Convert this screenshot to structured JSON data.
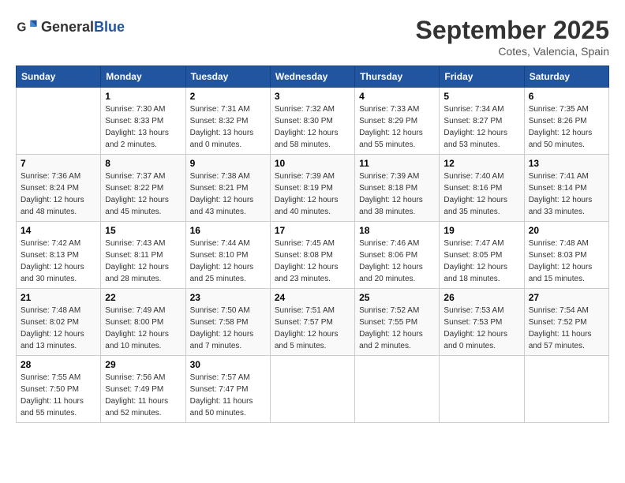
{
  "header": {
    "logo_general": "General",
    "logo_blue": "Blue",
    "month_title": "September 2025",
    "location": "Cotes, Valencia, Spain"
  },
  "days_of_week": [
    "Sunday",
    "Monday",
    "Tuesday",
    "Wednesday",
    "Thursday",
    "Friday",
    "Saturday"
  ],
  "weeks": [
    [
      {
        "day": "",
        "info": ""
      },
      {
        "day": "1",
        "info": "Sunrise: 7:30 AM\nSunset: 8:33 PM\nDaylight: 13 hours\nand 2 minutes."
      },
      {
        "day": "2",
        "info": "Sunrise: 7:31 AM\nSunset: 8:32 PM\nDaylight: 13 hours\nand 0 minutes."
      },
      {
        "day": "3",
        "info": "Sunrise: 7:32 AM\nSunset: 8:30 PM\nDaylight: 12 hours\nand 58 minutes."
      },
      {
        "day": "4",
        "info": "Sunrise: 7:33 AM\nSunset: 8:29 PM\nDaylight: 12 hours\nand 55 minutes."
      },
      {
        "day": "5",
        "info": "Sunrise: 7:34 AM\nSunset: 8:27 PM\nDaylight: 12 hours\nand 53 minutes."
      },
      {
        "day": "6",
        "info": "Sunrise: 7:35 AM\nSunset: 8:26 PM\nDaylight: 12 hours\nand 50 minutes."
      }
    ],
    [
      {
        "day": "7",
        "info": "Sunrise: 7:36 AM\nSunset: 8:24 PM\nDaylight: 12 hours\nand 48 minutes."
      },
      {
        "day": "8",
        "info": "Sunrise: 7:37 AM\nSunset: 8:22 PM\nDaylight: 12 hours\nand 45 minutes."
      },
      {
        "day": "9",
        "info": "Sunrise: 7:38 AM\nSunset: 8:21 PM\nDaylight: 12 hours\nand 43 minutes."
      },
      {
        "day": "10",
        "info": "Sunrise: 7:39 AM\nSunset: 8:19 PM\nDaylight: 12 hours\nand 40 minutes."
      },
      {
        "day": "11",
        "info": "Sunrise: 7:39 AM\nSunset: 8:18 PM\nDaylight: 12 hours\nand 38 minutes."
      },
      {
        "day": "12",
        "info": "Sunrise: 7:40 AM\nSunset: 8:16 PM\nDaylight: 12 hours\nand 35 minutes."
      },
      {
        "day": "13",
        "info": "Sunrise: 7:41 AM\nSunset: 8:14 PM\nDaylight: 12 hours\nand 33 minutes."
      }
    ],
    [
      {
        "day": "14",
        "info": "Sunrise: 7:42 AM\nSunset: 8:13 PM\nDaylight: 12 hours\nand 30 minutes."
      },
      {
        "day": "15",
        "info": "Sunrise: 7:43 AM\nSunset: 8:11 PM\nDaylight: 12 hours\nand 28 minutes."
      },
      {
        "day": "16",
        "info": "Sunrise: 7:44 AM\nSunset: 8:10 PM\nDaylight: 12 hours\nand 25 minutes."
      },
      {
        "day": "17",
        "info": "Sunrise: 7:45 AM\nSunset: 8:08 PM\nDaylight: 12 hours\nand 23 minutes."
      },
      {
        "day": "18",
        "info": "Sunrise: 7:46 AM\nSunset: 8:06 PM\nDaylight: 12 hours\nand 20 minutes."
      },
      {
        "day": "19",
        "info": "Sunrise: 7:47 AM\nSunset: 8:05 PM\nDaylight: 12 hours\nand 18 minutes."
      },
      {
        "day": "20",
        "info": "Sunrise: 7:48 AM\nSunset: 8:03 PM\nDaylight: 12 hours\nand 15 minutes."
      }
    ],
    [
      {
        "day": "21",
        "info": "Sunrise: 7:48 AM\nSunset: 8:02 PM\nDaylight: 12 hours\nand 13 minutes."
      },
      {
        "day": "22",
        "info": "Sunrise: 7:49 AM\nSunset: 8:00 PM\nDaylight: 12 hours\nand 10 minutes."
      },
      {
        "day": "23",
        "info": "Sunrise: 7:50 AM\nSunset: 7:58 PM\nDaylight: 12 hours\nand 7 minutes."
      },
      {
        "day": "24",
        "info": "Sunrise: 7:51 AM\nSunset: 7:57 PM\nDaylight: 12 hours\nand 5 minutes."
      },
      {
        "day": "25",
        "info": "Sunrise: 7:52 AM\nSunset: 7:55 PM\nDaylight: 12 hours\nand 2 minutes."
      },
      {
        "day": "26",
        "info": "Sunrise: 7:53 AM\nSunset: 7:53 PM\nDaylight: 12 hours\nand 0 minutes."
      },
      {
        "day": "27",
        "info": "Sunrise: 7:54 AM\nSunset: 7:52 PM\nDaylight: 11 hours\nand 57 minutes."
      }
    ],
    [
      {
        "day": "28",
        "info": "Sunrise: 7:55 AM\nSunset: 7:50 PM\nDaylight: 11 hours\nand 55 minutes."
      },
      {
        "day": "29",
        "info": "Sunrise: 7:56 AM\nSunset: 7:49 PM\nDaylight: 11 hours\nand 52 minutes."
      },
      {
        "day": "30",
        "info": "Sunrise: 7:57 AM\nSunset: 7:47 PM\nDaylight: 11 hours\nand 50 minutes."
      },
      {
        "day": "",
        "info": ""
      },
      {
        "day": "",
        "info": ""
      },
      {
        "day": "",
        "info": ""
      },
      {
        "day": "",
        "info": ""
      }
    ]
  ]
}
